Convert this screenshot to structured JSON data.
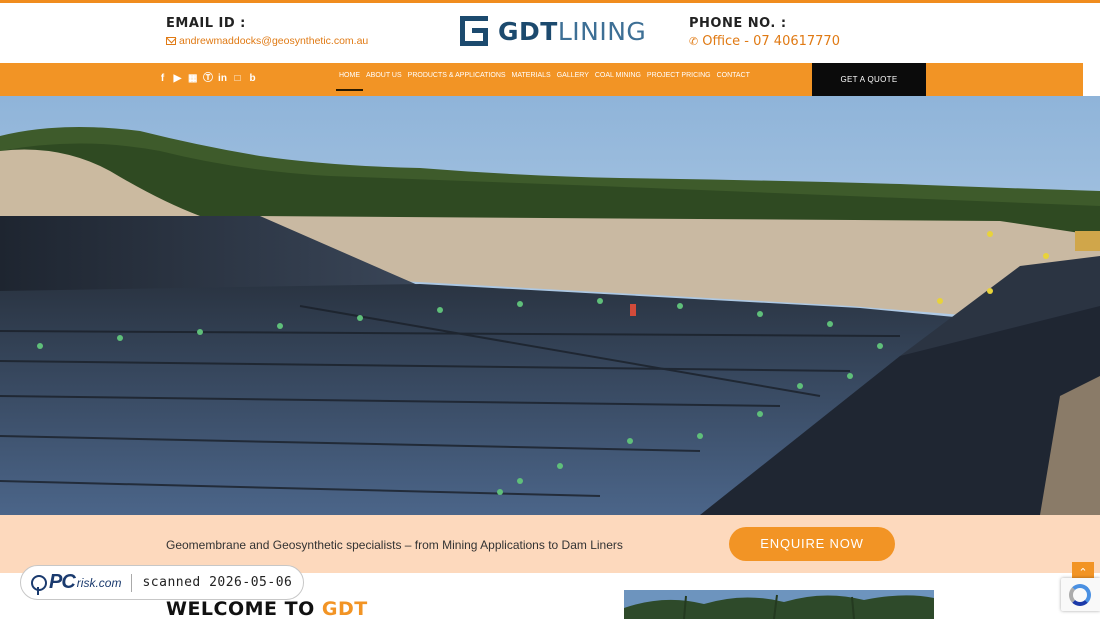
{
  "header": {
    "email_label": "EMAIL ID :",
    "email": "andrewmaddocks@geosynthetic.com.au",
    "logo_bold": "GDT",
    "logo_light": "LINING",
    "phone_label": "PHONE NO. :",
    "phone": "Office - 07 40617770"
  },
  "social_icons": [
    "facebook-icon",
    "youtube-icon",
    "map-icon",
    "pinterest-icon",
    "linkedin-icon",
    "instagram-icon",
    "blogger-icon"
  ],
  "nav": {
    "items": [
      "HOME",
      "ABOUT US",
      "PRODUCTS & APPLICATIONS",
      "MATERIALS",
      "GALLERY",
      "COAL MINING",
      "PROJECT PRICING",
      "CONTACT"
    ],
    "active": "HOME",
    "quote_label": "GET A QUOTE"
  },
  "band": {
    "tagline": "Geomembrane and Geosynthetic specialists – from Mining Applications to Dam Liners",
    "enquire_label": "ENQUIRE NOW"
  },
  "welcome": {
    "prefix": "WELCOME TO",
    "accent": "GDT"
  },
  "watermark": {
    "brand_pc": "PC",
    "brand_risk": "risk.com",
    "scanned": "scanned 2026-05-06"
  },
  "colors": {
    "accent": "#f29425",
    "brand_blue": "#1c4a6e",
    "band_bg": "#fdd9bd",
    "quote_bg": "#0b0b0b"
  }
}
